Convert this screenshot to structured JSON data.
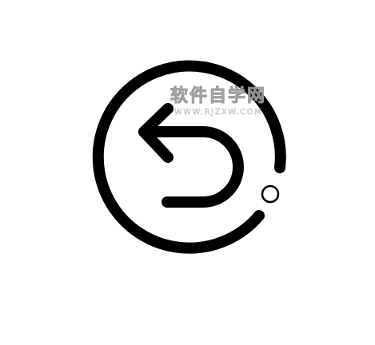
{
  "icon": {
    "name": "undo-arrow-circle-icon",
    "stroke_color": "#000000",
    "background_color": "#ffffff",
    "dot_fill": "#ffffff"
  },
  "watermark": {
    "title": "软件自学网",
    "url": "WWW.RJZXW.COM"
  }
}
